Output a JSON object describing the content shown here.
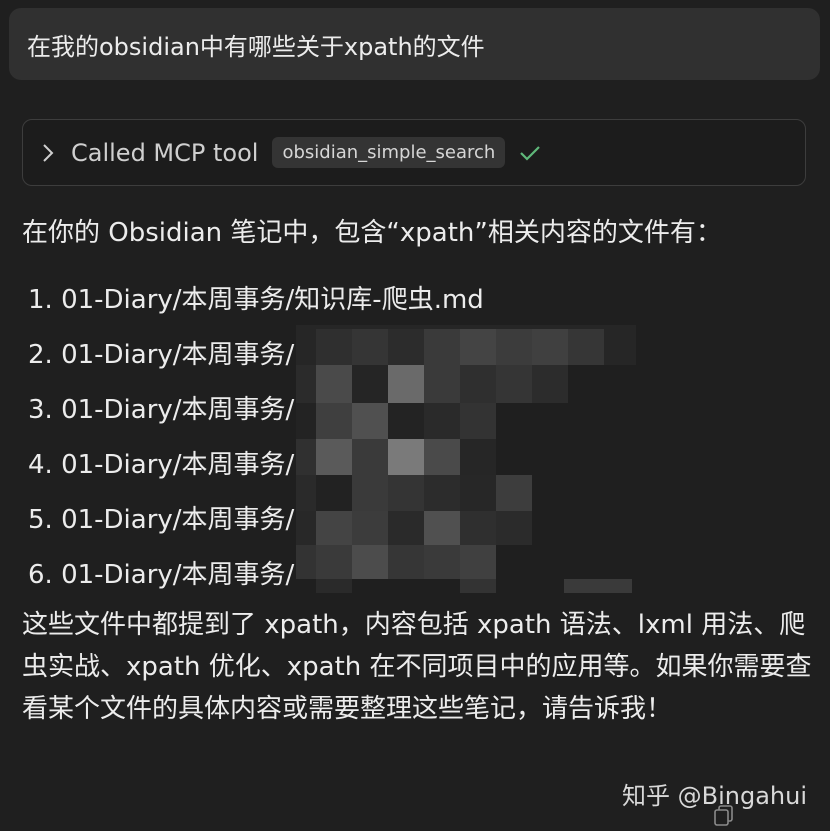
{
  "user_message": {
    "text": "在我的obsidian中有哪些关于xpath的文件"
  },
  "tool_call": {
    "expand_icon": "chevron-right-icon",
    "label": "Called MCP tool",
    "tool_name": "obsidian_simple_search",
    "status_icon": "check-icon",
    "status_color": "#5fb87a"
  },
  "reply": {
    "intro": "在你的 Obsidian 笔记中，包含“xpath”相关内容的文件有：",
    "files": [
      {
        "text": "1. 01-Diary/本周事务/知识库-爬虫.md"
      },
      {
        "text": "2. 01-Diary/本周事务/"
      },
      {
        "text": "3. 01-Diary/本周事务/"
      },
      {
        "text": "4. 01-Diary/本周事务/"
      },
      {
        "text": "5. 01-Diary/本周事务/"
      },
      {
        "text": "6. 01-Diary/本周事务/"
      }
    ],
    "summary": "这些文件中都提到了 xpath，内容包括 xpath 语法、lxml 用法、爬虫实战、xpath 优化、xpath 在不同项目中的应用等。如果你需要查看某个文件的具体内容或需要整理这些笔记，请告诉我！"
  },
  "watermark": {
    "text": "知乎 @Bingahui"
  },
  "footer": {
    "copy_icon": "copy-icon"
  }
}
